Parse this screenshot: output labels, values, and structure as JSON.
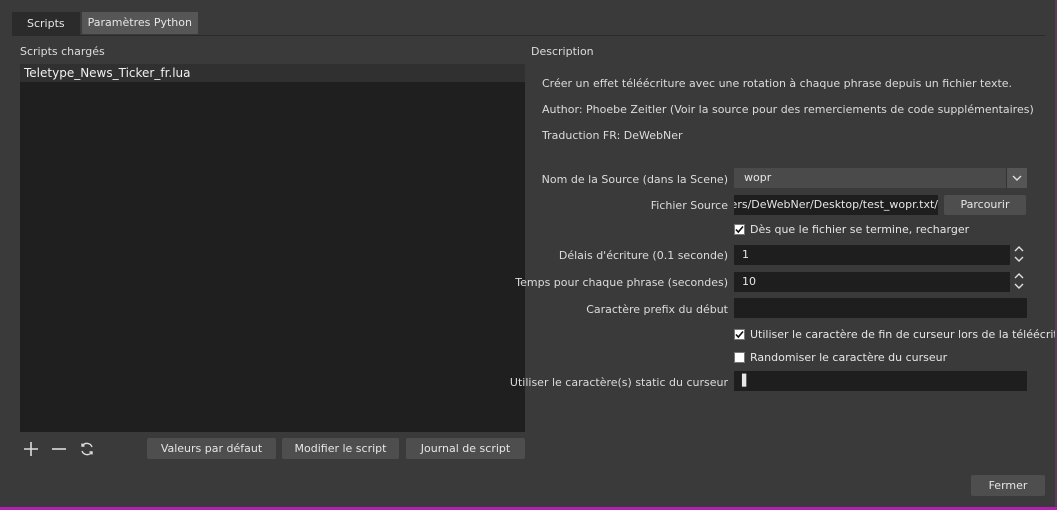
{
  "tabs": [
    {
      "label": "Scripts"
    },
    {
      "label": "Paramètres Python"
    }
  ],
  "left": {
    "heading": "Scripts chargés",
    "scripts": [
      "Teletype_News_Ticker_fr.lua"
    ],
    "icons": [
      "plus-icon",
      "minus-icon",
      "refresh-icon"
    ],
    "buttons": {
      "defaults": "Valeurs par défaut",
      "edit": "Modifier le script",
      "log": "Journal de script"
    }
  },
  "right": {
    "heading": "Description",
    "description": [
      "Créer un effet téléécriture avec une rotation à chaque phrase depuis un fichier texte.",
      "Author: Phoebe Zeitler (Voir la source pour des remerciements de code supplémentaires)",
      "Traduction FR: DeWebNer"
    ],
    "form": {
      "source_label": "Nom de la Source (dans la Scene)",
      "source_value": "wopr",
      "file_label": "Fichier Source",
      "file_value": "/Users/DeWebNer/Desktop/test_wopr.txt",
      "browse": "Parcourir",
      "reload_check": "Dès que le fichier se termine, recharger",
      "reload_checked": true,
      "delay_label": "Délais d'écriture (0.1 seconde)",
      "delay_value": "1",
      "phrase_label": "Temps pour chaque phrase (secondes)",
      "phrase_value": "10",
      "prefix_label": "Caractère prefix du début",
      "prefix_value": "",
      "cursor_end_check": "Utiliser le caractère de fin de curseur lors de la téléécritur",
      "cursor_end_checked": true,
      "random_check": "Randomiser le caractère du curseur",
      "random_checked": false,
      "static_label": "Utiliser le caractère(s) static du curseur",
      "static_value": "▌"
    }
  },
  "close": "Fermer",
  "colors": {
    "accent": "#b21fb2",
    "panel": "#3a3a3a",
    "field": "#1e1e1e"
  }
}
